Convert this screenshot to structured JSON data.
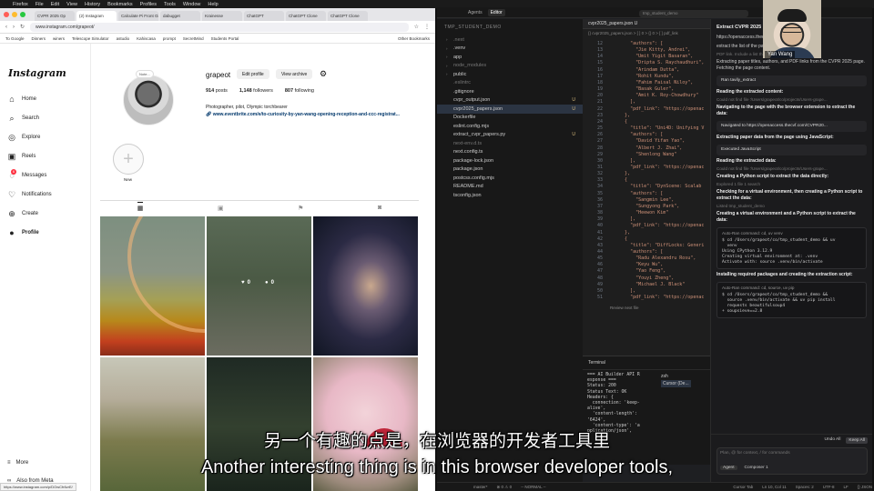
{
  "menubar": {
    "items": [
      "Firefox",
      "File",
      "Edit",
      "View",
      "History",
      "Bookmarks",
      "Profiles",
      "Tools",
      "Window",
      "Help"
    ]
  },
  "browser": {
    "tabs": [
      "CVPR 2025 Op",
      "(2) Instagram",
      "Calculate Pi Front Gi",
      "dabugget",
      "Krainesse",
      "ChatGPT",
      "ChatGPT Clone",
      "ChatGPT Clone"
    ],
    "url": "www.instagram.com/grapeot/",
    "bookmarks": [
      "To Google",
      "Dinners",
      "winers",
      "Telescope Simulator",
      "astudio",
      "Kahiscasa",
      "prompt",
      "SecretMind",
      "Students Portal",
      "Other Bookmarks"
    ],
    "status_url": "https://www.instagram.com/p/DOwCfr6vrE/"
  },
  "instagram": {
    "logo": "Instagram",
    "nav": [
      {
        "label": "Home",
        "icon": "home-icon",
        "glyph": "⌂"
      },
      {
        "label": "Search",
        "icon": "search-icon",
        "glyph": "⌕"
      },
      {
        "label": "Explore",
        "icon": "compass-icon",
        "glyph": "◎"
      },
      {
        "label": "Reels",
        "icon": "reels-icon",
        "glyph": "▣"
      },
      {
        "label": "Messages",
        "icon": "messenger-icon",
        "glyph": "◌"
      },
      {
        "label": "Notifications",
        "icon": "heart-icon",
        "glyph": "♡"
      },
      {
        "label": "Create",
        "icon": "plus-icon",
        "glyph": "⊕"
      },
      {
        "label": "Profile",
        "icon": "profile-icon",
        "glyph": "●"
      }
    ],
    "messages_badge": "6",
    "more": "More",
    "also_from_meta": "Also from Meta",
    "avatar_note": "Note...",
    "username": "grapeot",
    "edit_profile": "Edit profile",
    "view_archive": "View archive",
    "stats": {
      "posts": "914",
      "posts_label": "posts",
      "followers": "1,148",
      "followers_label": "followers",
      "following": "807",
      "following_label": "following"
    },
    "bio": "Photographer, pilot, Olympic torchbearer",
    "link": "www.eventbrite.com/e/to-curiosity-by-yan-wang-opening-reception-and-ccc-registrat...",
    "highlight_plus": "+",
    "highlight_label": "New",
    "hover_likes": "0",
    "hover_comments": "0"
  },
  "cursor": {
    "title_tabs": [
      "Agents",
      "Editor"
    ],
    "search": "tmp_student_demo",
    "explorer_title": "TMP_STUDENT_DEMO",
    "files": [
      {
        "name": ".next",
        "dim": true,
        "arrow": "›",
        "u": ""
      },
      {
        "name": ".venv",
        "dim": false,
        "arrow": "›",
        "u": ""
      },
      {
        "name": "app",
        "dim": false,
        "arrow": "›",
        "u": ""
      },
      {
        "name": "node_modules",
        "dim": true,
        "arrow": "›",
        "u": ""
      },
      {
        "name": "public",
        "dim": false,
        "arrow": "›",
        "u": ""
      },
      {
        "name": ".eslintrc",
        "dim": true,
        "arrow": "",
        "u": ""
      },
      {
        "name": ".gitignore",
        "dim": false,
        "arrow": "",
        "u": ""
      },
      {
        "name": "cvpr_output.json",
        "dim": false,
        "arrow": "",
        "u": "U"
      },
      {
        "name": "cvpr2025_papers.json",
        "dim": false,
        "arrow": "",
        "u": "U",
        "sel": true
      },
      {
        "name": "Dockerfile",
        "dim": false,
        "arrow": "",
        "u": ""
      },
      {
        "name": "eslint.config.mjs",
        "dim": false,
        "arrow": "",
        "u": ""
      },
      {
        "name": "extract_cvpr_papers.py",
        "dim": false,
        "arrow": "",
        "u": "U"
      },
      {
        "name": "next-env.d.ts",
        "dim": true,
        "arrow": "",
        "u": ""
      },
      {
        "name": "next.config.ts",
        "dim": false,
        "arrow": "",
        "u": ""
      },
      {
        "name": "package-lock.json",
        "dim": false,
        "arrow": "",
        "u": ""
      },
      {
        "name": "package.json",
        "dim": false,
        "arrow": "",
        "u": ""
      },
      {
        "name": "postcss.config.mjs",
        "dim": false,
        "arrow": "",
        "u": ""
      },
      {
        "name": "README.md",
        "dim": false,
        "arrow": "",
        "u": ""
      },
      {
        "name": "tsconfig.json",
        "dim": false,
        "arrow": "",
        "u": ""
      }
    ],
    "editor_tab": "cvpr2025_papers.json U",
    "breadcrumb": "{} cvpr2025_papers.json > [ ] 0 > {} 0 > [ ] pdf_link",
    "code_lines": [
      [
        "12",
        "        \"authors\": ["
      ],
      [
        "13",
        "          \"Jie Kitty, Andrei\","
      ],
      [
        "14",
        "          \"Umit Yigit Basaran\","
      ],
      [
        "15",
        "          \"Dripta S. Raychaudhuri\","
      ],
      [
        "16",
        "          \"Arindam Dutta\","
      ],
      [
        "17",
        "          \"Rohit Kundu\","
      ],
      [
        "18",
        "          \"Fahim Faisal Niloy\","
      ],
      [
        "19",
        "          \"Basak Guler\","
      ],
      [
        "20",
        "          \"Amit K. Roy-Chowdhury\""
      ],
      [
        "21",
        "        ],"
      ],
      [
        "22",
        "        \"pdf_link\": \"https://openac"
      ],
      [
        "23",
        "      },"
      ],
      [
        "24",
        "      {"
      ],
      [
        "25",
        "        \"title\": \"Uni4D: Unifying V"
      ],
      [
        "26",
        "        \"authors\": ["
      ],
      [
        "27",
        "          \"David Yifan Yao\","
      ],
      [
        "28",
        "          \"Albert J. Zhai\","
      ],
      [
        "29",
        "          \"Shenlong Wang\""
      ],
      [
        "30",
        "        ],"
      ],
      [
        "31",
        "        \"pdf_link\": \"https://openac"
      ],
      [
        "32",
        "      },"
      ],
      [
        "33",
        "      {"
      ],
      [
        "34",
        "        \"title\": \"DynScene: Scalab"
      ],
      [
        "35",
        "        \"authors\": ["
      ],
      [
        "36",
        "          \"Sangmin Lee\","
      ],
      [
        "37",
        "          \"Sungyong Park\","
      ],
      [
        "38",
        "          \"Heewon Kim\""
      ],
      [
        "39",
        "        ],"
      ],
      [
        "40",
        "        \"pdf_link\": \"https://openac"
      ],
      [
        "41",
        "      },"
      ],
      [
        "42",
        "      {"
      ],
      [
        "43",
        "        \"title\": \"DiffLocks: Generi"
      ],
      [
        "44",
        "        \"authors\": ["
      ],
      [
        "45",
        "          \"Radu Alexandru Rosu\","
      ],
      [
        "46",
        "          \"Keyu Wu\","
      ],
      [
        "47",
        "          \"Yao Feng\","
      ],
      [
        "48",
        "          \"Youyi Zheng\","
      ],
      [
        "49",
        "          \"Michael J. Black\""
      ],
      [
        "50",
        "        ],"
      ],
      [
        "51",
        "        \"pdf_link\": \"https://openac"
      ]
    ],
    "review_hint": "Review next file",
    "terminal_title": "Terminal",
    "terminal_lines": "=== AI Builder API R\nesponse ===\nStatus: 200\nStatus Text: OK\nHeaders: {\n  connection: 'keep-\nalive',\n  'content-length':\n'6424',\n  'content-type': 'a\npplication/json',",
    "terminal_sessions": [
      "zsh",
      "Cursor (De..."
    ],
    "agent": {
      "title": "Extract CVPR 2025 pap...",
      "url": "https://openaccess.thecvf.com/",
      "prompt": "extract the list of the pap...",
      "prompt_sub": "PDF link. Include a list th...",
      "para1": "Extracting paper titles, authors, and PDF links from the CVPR 2025 page. Fetching the page content.",
      "chip1": "Ran tavily_extract",
      "h1": "Reading the extracted content:",
      "dim1": "Could not find file '/Users/grapeot/co/projects/Users-grape...",
      "para2": "Navigating to the page with the browser extension to extract the data:",
      "chip2": "Navigated to https://openaccess.thecvf.com/CVPR20...",
      "para3": "Extracting paper data from the page using JavaScript:",
      "chip3": "Executed JavaScript",
      "h2": "Reading the extracted data:",
      "dim2": "Could not find file '/Users/grapeot/co/projects/Users-grape...",
      "para4": "Creating a Python script to extract the data directly:",
      "dim3": "Explored 1 file 1 search",
      "para5": "Checking for a virtual environment, then creating a Python script to extract the data:",
      "dim4": "Listed tmp_student_demo",
      "para6": "Creating a virtual environment and a Python script to extract the data:",
      "cmd1_head": "Auto-Ran command: cd, uv venv",
      "cmd1": "$ cd /Users/grapeot/co/tmp_student_demo && uv\n  venv\nUsing CPython 3.12.9\nCreating virtual environment at: .venv\nActivate with: source .venv/bin/activate",
      "para7": "Installing required packages and creating the extraction script:",
      "cmd2_head": "Auto-Ran command: cd, source, uv pip",
      "cmd2": "$ cd /Users/grapeot/co/tmp_student_demo &&\n  source .venv/bin/activate && uv pip install\n  requests beautifulsoup4\n+ soupsieve==2.8",
      "undo_all": "Undo All",
      "keep_all": "Keep All",
      "input_placeholder": "Plan, @ for context, / for commands",
      "mode": "Agent",
      "model": "Composer 1"
    },
    "statusbar": [
      "master*",
      "⊗ 0 ⚠ 0",
      "-- NORMAL --",
      "Cursor Tab",
      "Ln 10, Col 11",
      "Spaces: 2",
      "UTF-8",
      "LF",
      "{} JSON"
    ]
  },
  "webcam": {
    "name": "Yan Wang"
  },
  "subtitles": {
    "zh": "另一个有趣的点是，在浏览器的开发者工具里",
    "en": "Another interesting thing is in this browser developer tools,"
  }
}
